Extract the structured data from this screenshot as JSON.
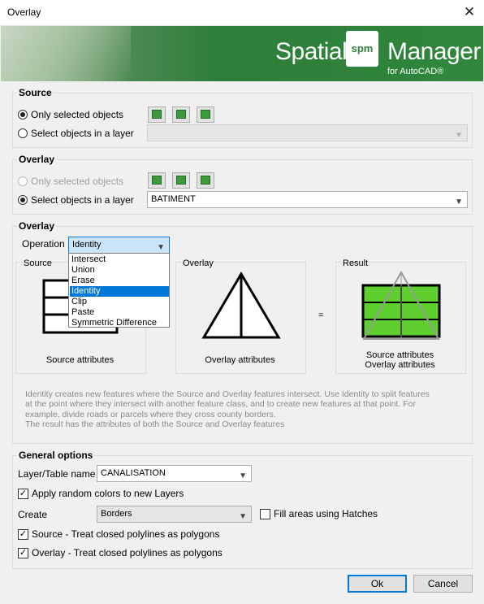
{
  "window": {
    "title": "Overlay",
    "close_glyph": "✕"
  },
  "banner": {
    "spatial": "Spatial",
    "logo_mark": "spm",
    "manager": "Manager",
    "subtitle": "for AutoCAD®"
  },
  "source": {
    "title": "Source",
    "option1": "Only selected objects",
    "option2": "Select objects in a layer",
    "layer_value": ""
  },
  "overlay_sel": {
    "title": "Overlay",
    "option1": "Only selected objects",
    "option2": "Select objects in a layer",
    "layer_value": "BATIMENT"
  },
  "operation": {
    "title": "Overlay",
    "label": "Operation",
    "value": "Identity",
    "options": [
      "Intersect",
      "Union",
      "Erase",
      "Identity",
      "Clip",
      "Paste",
      "Symmetric Difference"
    ],
    "selected": "Identity"
  },
  "panels": {
    "source_label": "Source",
    "source_caption": "Source attributes",
    "overlay_label": "Overlay",
    "overlay_caption": "Overlay attributes",
    "equals": "=",
    "result_label": "Result",
    "result_caption1": "Source attributes",
    "result_caption2": "Overlay attributes"
  },
  "description": [
    "Identity creates new features where the Source and Overlay features intersect. Use Identity to split features",
    "at the point where they intersect with another feature class, and to create new features at that point. For",
    "example, divide roads or parcels where they cross county borders.",
    "The result has the attributes of both the Source and Overlay features"
  ],
  "general": {
    "title": "General options",
    "layer_label": "Layer/Table name",
    "layer_value": "CANALISATION",
    "random_colors": "Apply random colors to new Layers",
    "create_label": "Create",
    "create_value": "Borders",
    "fill_hatches": "Fill areas using Hatches",
    "source_closed": "Source - Treat closed polylines as polygons",
    "overlay_closed": "Overlay - Treat closed polylines as polygons",
    "check_glyph": "✓"
  },
  "buttons": {
    "ok": "Ok",
    "cancel": "Cancel"
  },
  "colors": {
    "accent": "#0078d7",
    "banner_green": "#2e7d3a",
    "result_fill": "#5fcf2f"
  },
  "icons": [
    "close-icon",
    "select-objects-icon",
    "filter-icon",
    "table-icon",
    "chevron-down-icon",
    "check-icon"
  ]
}
